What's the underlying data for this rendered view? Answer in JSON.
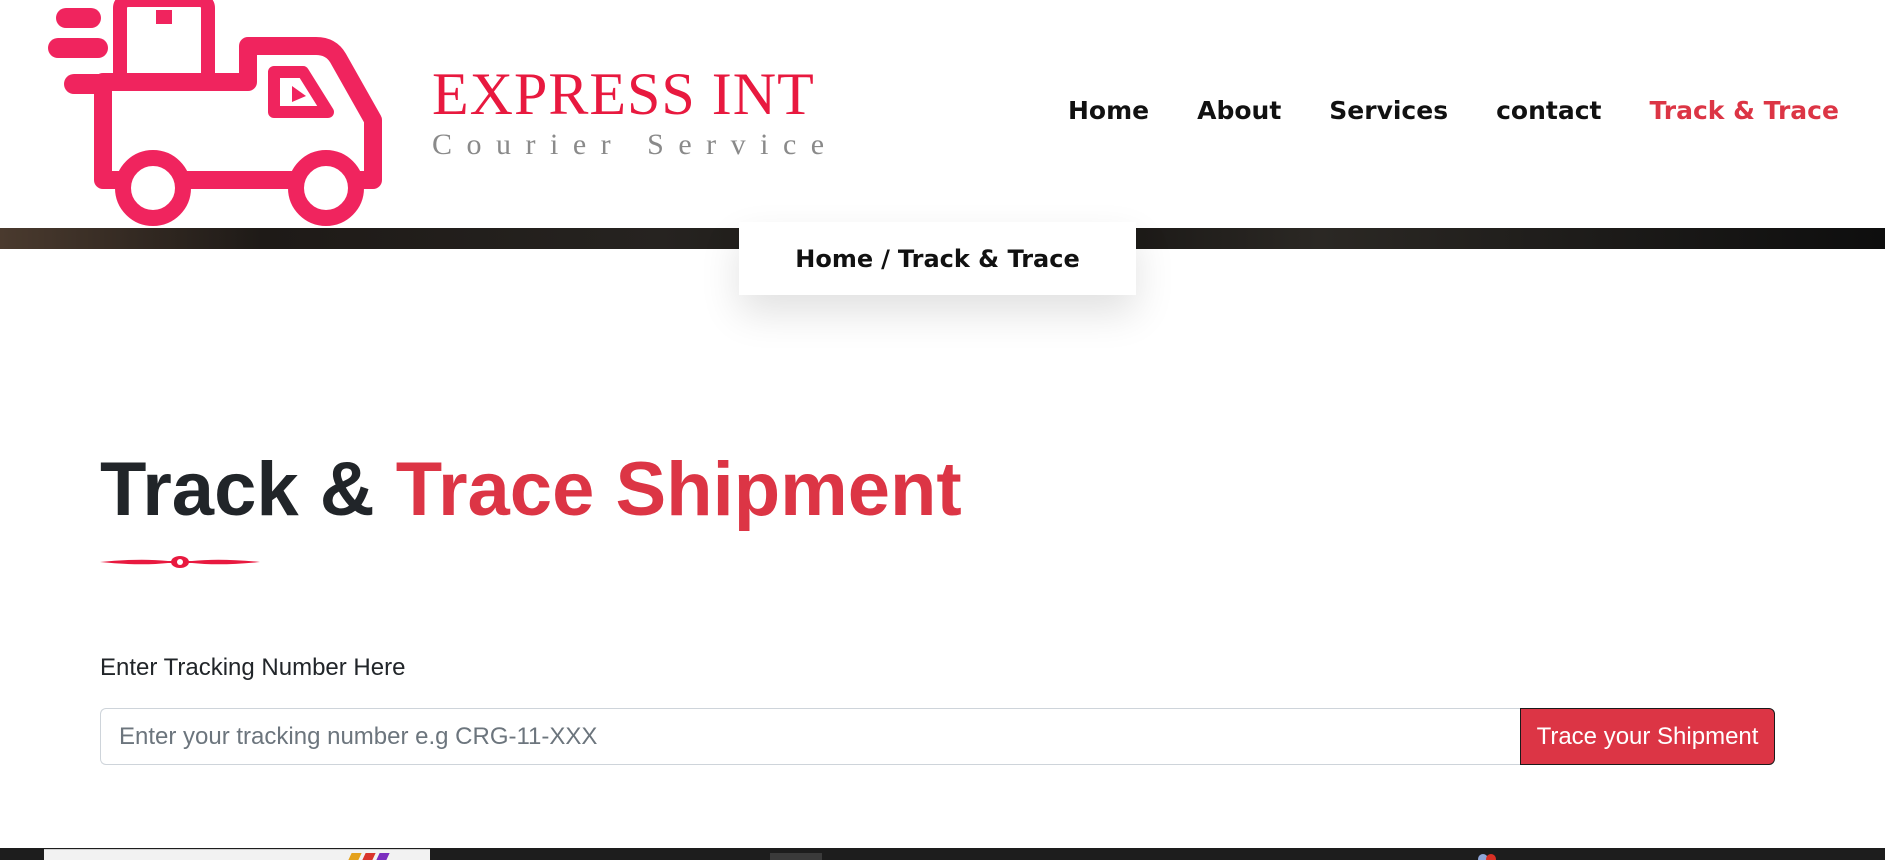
{
  "brand": {
    "title": "EXPRESS INT",
    "tagline": "Courier Service",
    "colors": {
      "primary": "#e8193f",
      "tagline": "#8a8a8a"
    }
  },
  "nav": {
    "items": [
      {
        "label": "Home",
        "active": false
      },
      {
        "label": "About",
        "active": false
      },
      {
        "label": "Services",
        "active": false
      },
      {
        "label": "contact",
        "active": false
      },
      {
        "label": "Track & Trace",
        "active": true
      }
    ]
  },
  "breadcrumb": {
    "home": "Home",
    "separator": "/",
    "current": "Track & Trace"
  },
  "page": {
    "title_part1": "Track & ",
    "title_part2": "Trace Shipment"
  },
  "form": {
    "label": "Enter Tracking Number Here",
    "input_value": "",
    "placeholder": "Enter your tracking number e.g CRG-11-XXX",
    "button_label": "Trace your Shipment"
  },
  "theme": {
    "accent": "#dc3545",
    "text": "#212529",
    "footer": "#1d1d1d"
  },
  "icons": {
    "logo": "delivery-truck-icon",
    "divider": "ornament-divider-icon"
  }
}
